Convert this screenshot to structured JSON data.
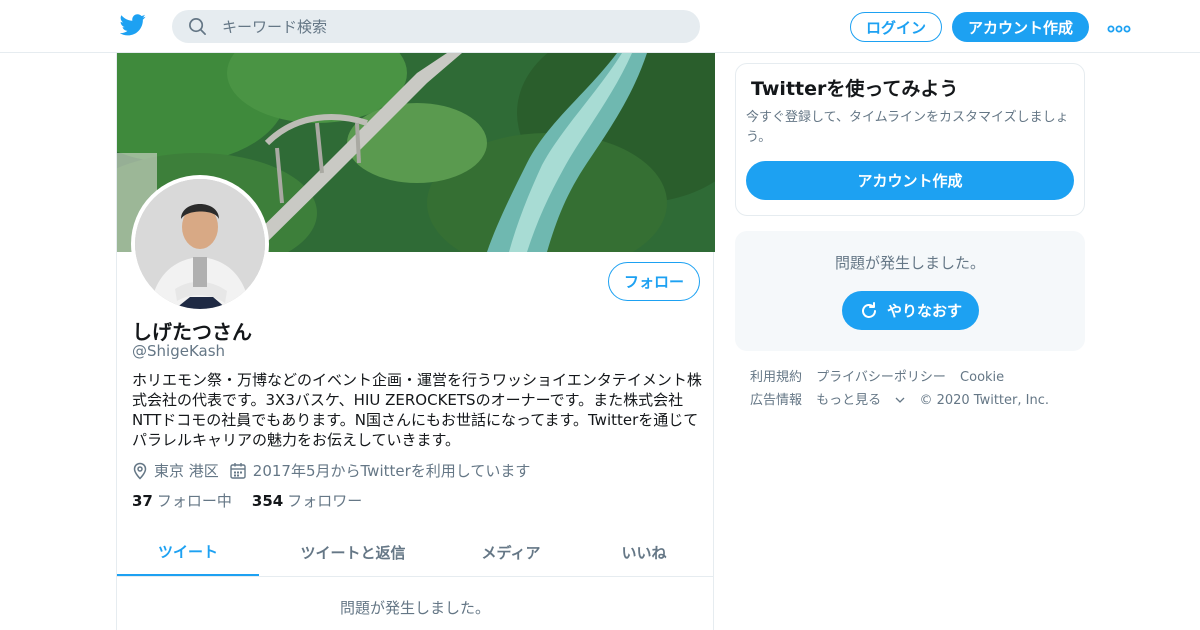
{
  "colors": {
    "accent": "#1da1f2",
    "text_primary": "#14171a",
    "text_secondary": "#657786",
    "border": "#e6ecf0",
    "panel_bg": "#f5f8fa"
  },
  "header": {
    "logo_icon": "twitter-bird-icon",
    "search_placeholder": "キーワード検索",
    "login_label": "ログイン",
    "signup_label": "アカウント作成",
    "more_icon": "more-dots-icon"
  },
  "profile": {
    "follow_label": "フォロー",
    "name": "しげたつさん",
    "handle": "@ShigeKash",
    "bio": "ホリエモン祭・万博などのイベント企画・運営を行うワッショイエンタテイメント株式会社の代表です。3X3バスケ、HIU ZEROCKETSのオーナーです。また株式会社NTTドコモの社員でもあります。N国さんにもお世話になってます。Twitterを通じてパラレルキャリアの魅力をお伝えしていきます。",
    "location": "東京 港区",
    "joined": "2017年5月からTwitterを利用しています",
    "following_count": "37",
    "following_label": "フォロー中",
    "followers_count": "354",
    "followers_label": "フォロワー"
  },
  "tabs": [
    {
      "label": "ツイート"
    },
    {
      "label": "ツイートと返信"
    },
    {
      "label": "メディア"
    },
    {
      "label": "いいね"
    }
  ],
  "timeline": {
    "error": "問題が発生しました。"
  },
  "sidebar": {
    "signup_card": {
      "title": "Twitterを使ってみよう",
      "desc": "今すぐ登録して、タイムラインをカスタマイズしましょう。",
      "button": "アカウント作成"
    },
    "error_card": {
      "message": "問題が発生しました。",
      "retry_label": "やりなおす"
    },
    "footer": {
      "links": [
        "利用規約",
        "プライバシーポリシー",
        "Cookie",
        "広告情報",
        "もっと見る"
      ],
      "copyright": "© 2020 Twitter, Inc."
    }
  }
}
